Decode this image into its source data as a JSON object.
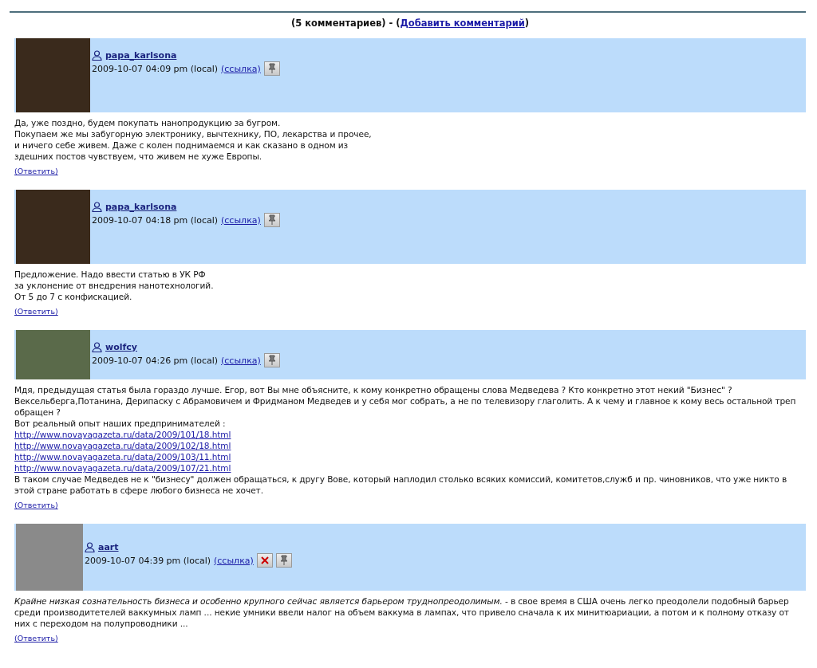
{
  "header": {
    "count": "(5 комментариев) - (",
    "add_link": "Добавить комментарий",
    "close": ")"
  },
  "comments": [
    {
      "author": "papa_karlsona",
      "time": "2009-10-07 04:09 pm (local)",
      "link": "(ссылка)",
      "buttons": [
        {
          "kind": "pin"
        }
      ],
      "blocks": [
        {
          "kind": "line",
          "text": "Да, уже поздно, будем покупать нанопродукцию за бугром."
        },
        {
          "kind": "line",
          "text": "Покупаем же мы забугорную электронику, вычтехнику, ПО, лекарства и прочее,"
        },
        {
          "kind": "line",
          "text": "и ничего себе живем. Даже с колен поднимаемся и как сказано в одном из"
        },
        {
          "kind": "line",
          "text": "здешних постов чувствуем, что живем не хуже Европы."
        }
      ],
      "reply": "(Ответить)"
    },
    {
      "author": "papa_karlsona",
      "time": "2009-10-07 04:18 pm (local)",
      "link": "(ссылка)",
      "buttons": [
        {
          "kind": "pin"
        }
      ],
      "blocks": [
        {
          "kind": "line",
          "text": "Предложение. Надо ввести статью в УК РФ"
        },
        {
          "kind": "line",
          "text": "за уклонение от внедрения нанотехнологий."
        },
        {
          "kind": "line",
          "text": "От 5 до 7 с конфискацией."
        }
      ],
      "reply": "(Ответить)"
    },
    {
      "author": "wolfcy",
      "time": "2009-10-07 04:26 pm (local)",
      "link": "(ссылка)",
      "buttons": [
        {
          "kind": "pin"
        }
      ],
      "blocks": [
        {
          "kind": "line",
          "text": "Мдя, предыдущая статья была гораздо лучше. Егор, вот Вы мне объясните, к кому конкретно обращены слова Медведева ? Кто конкретно этот некий \"Бизнес\" ? Вексельберга,Потанина, Дерипаску с Абрамовичем и Фридманом Медведев и у себя мог собрать, а не по телевизору глаголить. А к чему и главное к кому весь остальной треп обращен ?"
        },
        {
          "kind": "line",
          "text": "Вот реальный опыт наших предпринимателей :"
        },
        {
          "kind": "url",
          "text": "http://www.novayagazeta.ru/data/2009/101/18.html"
        },
        {
          "kind": "url",
          "text": "http://www.novayagazeta.ru/data/2009/102/18.html"
        },
        {
          "kind": "url",
          "text": "http://www.novayagazeta.ru/data/2009/103/11.html"
        },
        {
          "kind": "url",
          "text": "http://www.novayagazeta.ru/data/2009/107/21.html"
        },
        {
          "kind": "line",
          "text": "В таком случае Медведев не к \"бизнесу\" должен обращаться, к другу Вове, который наплодил столько всяких комиссий, комитетов,служб и пр. чиновников, что уже никто в этой стране работать в сфере любого бизнеса не хочет."
        }
      ],
      "reply": "(Ответить)"
    },
    {
      "author": "aart",
      "time": "2009-10-07 04:39 pm (local)",
      "link": "(ссылка)",
      "buttons": [
        {
          "kind": "delete"
        },
        {
          "kind": "pin"
        }
      ],
      "blocks": [
        {
          "kind": "line",
          "text": "*Крайне низкая сознательность бизнеса и особенно крупного сейчас является барьером труднопреодолимым.* - в свое время в США очень легко преодолели подобный барьер среди производитетелей ваккумных ламп ... некие умники ввели налог на объем ваккума в лампах, что привело сначала к их минитюариации, а потом и к полному отказу от них с переходом на полупроводники ..."
        }
      ],
      "reply": "(Ответить)"
    }
  ]
}
